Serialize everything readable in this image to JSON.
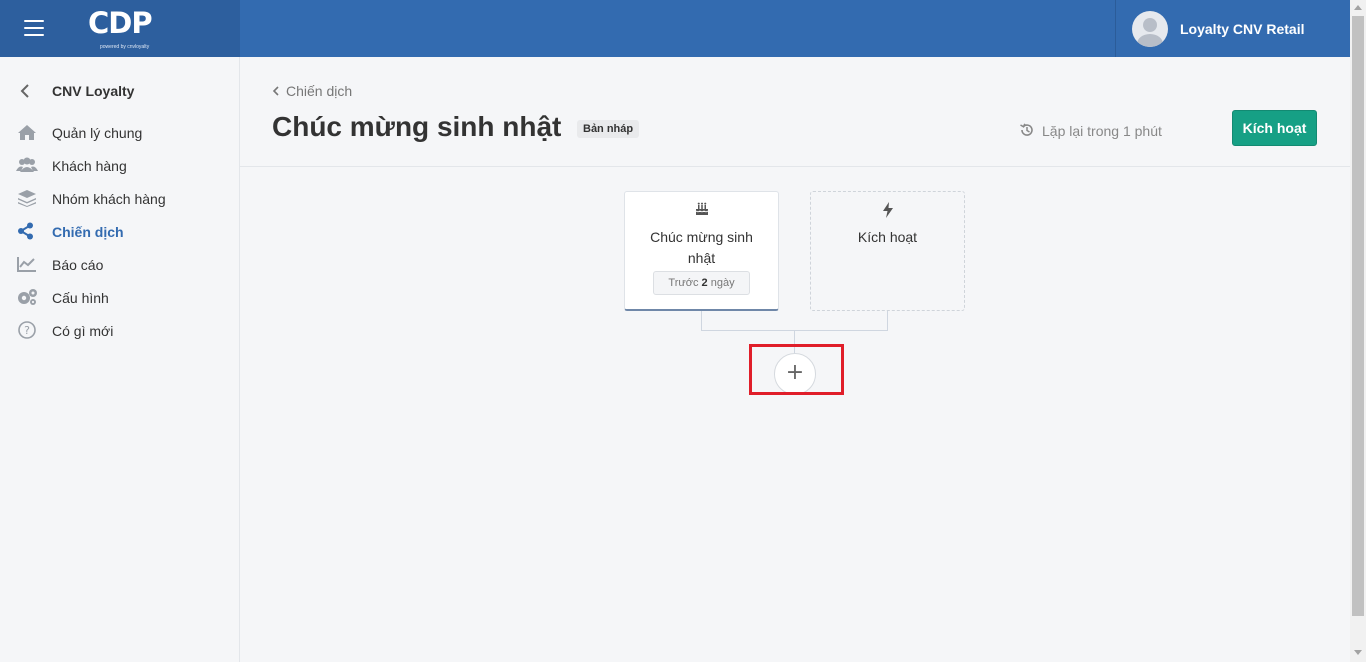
{
  "brand": {
    "logo_text": "CDP",
    "logo_sub": "powered by cnvloyalty"
  },
  "user": {
    "name": "Loyalty CNV Retail"
  },
  "sidebar": {
    "back_title": "CNV Loyalty",
    "items": [
      {
        "label": "Quản lý chung",
        "icon": "home-icon"
      },
      {
        "label": "Khách hàng",
        "icon": "users-icon"
      },
      {
        "label": "Nhóm khách hàng",
        "icon": "layers-icon"
      },
      {
        "label": "Chiến dịch",
        "icon": "share-icon",
        "active": true
      },
      {
        "label": "Báo cáo",
        "icon": "chart-icon"
      },
      {
        "label": "Cấu hình",
        "icon": "gears-icon"
      },
      {
        "label": "Có gì mới",
        "icon": "question-icon"
      }
    ]
  },
  "header": {
    "breadcrumb": "Chiến dịch",
    "title": "Chúc mừng sinh nhật",
    "status_badge": "Bản nháp",
    "repeat_text": "Lặp lại trong 1 phút",
    "activate_label": "Kích hoạt"
  },
  "flow": {
    "event_card": {
      "label": "Chúc mừng sinh nhật",
      "icon": "birthday-cake-icon",
      "pill_prefix": "Trước",
      "pill_number": "2",
      "pill_suffix": "ngày"
    },
    "trigger_card": {
      "label": "Kích hoạt",
      "icon": "bolt-icon"
    },
    "add_button": "+"
  },
  "colors": {
    "topbar": "#336bb0",
    "accent": "#336bb0",
    "activate": "#16a085",
    "highlight": "#e01e2a"
  }
}
